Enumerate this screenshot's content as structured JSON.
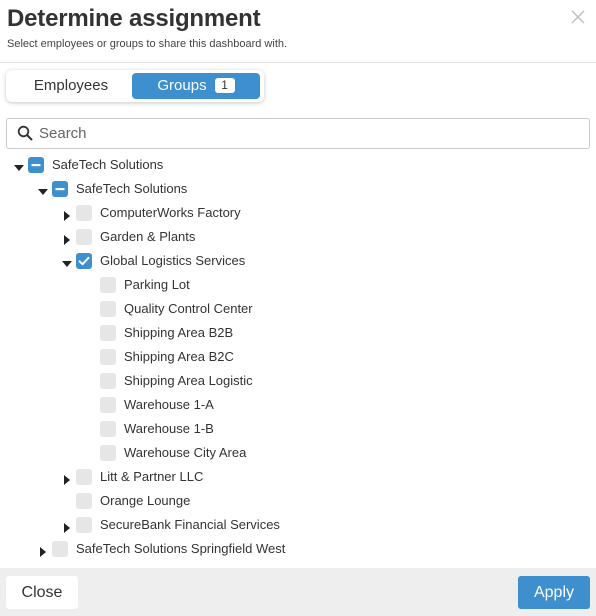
{
  "dialog": {
    "title": "Determine assignment",
    "subtitle": "Select employees or groups to share this dashboard with."
  },
  "tabs": {
    "employees_label": "Employees",
    "groups_label": "Groups",
    "groups_count": "1",
    "active": "Groups"
  },
  "search": {
    "placeholder": "Search",
    "value": ""
  },
  "tree": [
    {
      "label": "SafeTech Solutions",
      "level": 0,
      "expander": "expanded",
      "state": "partial"
    },
    {
      "label": "SafeTech Solutions",
      "level": 1,
      "expander": "expanded",
      "state": "partial"
    },
    {
      "label": "ComputerWorks Factory",
      "level": 2,
      "expander": "collapsed",
      "state": "unchecked"
    },
    {
      "label": "Garden & Plants",
      "level": 2,
      "expander": "collapsed",
      "state": "unchecked"
    },
    {
      "label": "Global Logistics Services",
      "level": 2,
      "expander": "expanded",
      "state": "checked"
    },
    {
      "label": "Parking Lot",
      "level": 3,
      "expander": "none",
      "state": "unchecked"
    },
    {
      "label": "Quality Control Center",
      "level": 3,
      "expander": "none",
      "state": "unchecked"
    },
    {
      "label": "Shipping Area B2B",
      "level": 3,
      "expander": "none",
      "state": "unchecked"
    },
    {
      "label": "Shipping Area B2C",
      "level": 3,
      "expander": "none",
      "state": "unchecked"
    },
    {
      "label": "Shipping Area Logistic",
      "level": 3,
      "expander": "none",
      "state": "unchecked"
    },
    {
      "label": "Warehouse 1-A",
      "level": 3,
      "expander": "none",
      "state": "unchecked"
    },
    {
      "label": "Warehouse 1-B",
      "level": 3,
      "expander": "none",
      "state": "unchecked"
    },
    {
      "label": "Warehouse City Area",
      "level": 3,
      "expander": "none",
      "state": "unchecked"
    },
    {
      "label": "Litt & Partner LLC",
      "level": 2,
      "expander": "collapsed",
      "state": "unchecked"
    },
    {
      "label": "Orange Lounge",
      "level": 2,
      "expander": "none",
      "state": "unchecked"
    },
    {
      "label": "SecureBank Financial Services",
      "level": 2,
      "expander": "collapsed",
      "state": "unchecked"
    },
    {
      "label": "SafeTech Solutions Springfield West",
      "level": 1,
      "expander": "collapsed",
      "state": "unchecked"
    }
  ],
  "footer": {
    "close_label": "Close",
    "apply_label": "Apply"
  },
  "colors": {
    "accent": "#3d8fce",
    "footer_bg": "#eeeeee",
    "checkbox_empty": "#e6e6e6"
  },
  "icons": {
    "close": "close-icon",
    "search": "search-icon",
    "expanded": "caret-down-icon",
    "collapsed": "caret-right-icon"
  }
}
